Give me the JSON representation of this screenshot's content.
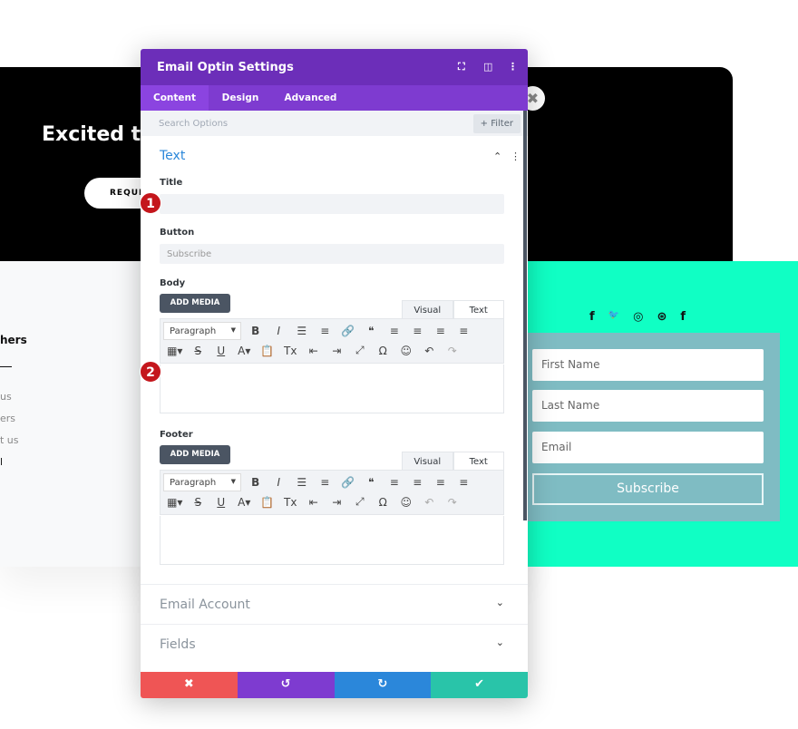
{
  "background": {
    "hero_title": "Excited to",
    "hero_button": "REQUES",
    "footer_heading": "hers",
    "footer_links": [
      "us",
      "ers",
      "t us",
      "l"
    ]
  },
  "optin": {
    "social_icons": [
      "facebook-icon",
      "twitter-icon",
      "instagram-icon",
      "dribbble-icon",
      "facebook-icon"
    ],
    "social_glyphs": [
      "f",
      "🐦",
      "◎",
      "⊛",
      "f"
    ],
    "first_name": "First Name",
    "last_name": "Last Name",
    "email": "Email",
    "button": "Subscribe",
    "colors": {
      "teal": "#10ffc4",
      "form_bg": "#7fbcc3"
    }
  },
  "modal": {
    "title": "Email Optin Settings",
    "header_icons": [
      "⛶",
      "◫",
      "⋮"
    ],
    "tabs": [
      "Content",
      "Design",
      "Advanced"
    ],
    "active_tab": "Content",
    "search_placeholder": "Search Options",
    "filter_label": "+ Filter",
    "section_title": "Text",
    "title_label": "Title",
    "title_value": "",
    "button_label": "Button",
    "button_placeholder": "Subscribe",
    "body_label": "Body",
    "footer_label": "Footer",
    "add_media": "ADD MEDIA",
    "visual_tab": "Visual",
    "text_tab": "Text",
    "paragraph": "Paragraph",
    "toolbar_row1": [
      "B",
      "I",
      "☰",
      "≡",
      "🔗",
      "❝",
      "≡",
      "≡",
      "≡",
      "≡"
    ],
    "toolbar_row2": [
      "▦▾",
      "S",
      "U",
      "A▾",
      "📋",
      "Tx",
      "⇤",
      "⇥",
      "⤢",
      "Ω",
      "☺",
      "↶",
      "↷"
    ],
    "collapsed_sections": [
      "Email Account",
      "Fields"
    ],
    "badges": [
      "1",
      "2"
    ],
    "actions": {
      "cancel": "✖",
      "undo": "↺",
      "redo": "↻",
      "save": "✔"
    },
    "colors": {
      "header": "#6c2eb9",
      "tabs": "#7e3bd0",
      "cancel": "#ef5555",
      "undo": "#7e3bd0",
      "redo": "#2b87da",
      "save": "#29c4a9",
      "section_title": "#2b87da"
    }
  }
}
